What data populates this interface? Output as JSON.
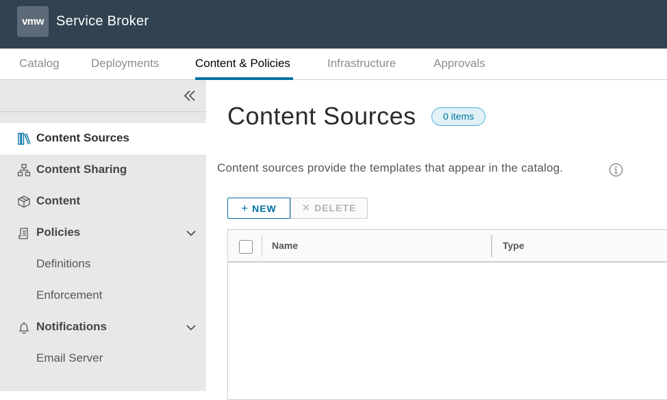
{
  "header": {
    "logo_text": "vmw",
    "app_title": "Service Broker"
  },
  "topnav": {
    "tabs": [
      {
        "label": "Catalog",
        "active": false
      },
      {
        "label": "Deployments",
        "active": false
      },
      {
        "label": "Content & Policies",
        "active": true
      },
      {
        "label": "Infrastructure",
        "active": false
      },
      {
        "label": "Approvals",
        "active": false
      }
    ]
  },
  "sidebar": {
    "collapse_icon": "double-chevron-left-icon",
    "items": [
      {
        "label": "Content Sources",
        "icon": "books-icon",
        "active": true
      },
      {
        "label": "Content Sharing",
        "icon": "network-icon",
        "active": false
      },
      {
        "label": "Content",
        "icon": "box-icon",
        "active": false
      },
      {
        "label": "Policies",
        "icon": "policy-document-icon",
        "expanded": true
      },
      {
        "label": "Definitions",
        "sub": true
      },
      {
        "label": "Enforcement",
        "sub": true
      },
      {
        "label": "Notifications",
        "icon": "bell-icon",
        "expanded": true
      },
      {
        "label": "Email Server",
        "sub": true
      }
    ]
  },
  "main": {
    "page_title": "Content Sources",
    "badge": "0 items",
    "description": "Content sources provide the templates that appear in the catalog.",
    "buttons": {
      "new_label": "NEW",
      "delete_label": "DELETE"
    },
    "grid": {
      "columns": [
        "Name",
        "Type"
      ],
      "rows": []
    }
  },
  "colors": {
    "header_bg": "#314351",
    "accent": "#0072a3",
    "sidebar_bg": "#e8e8e8"
  }
}
